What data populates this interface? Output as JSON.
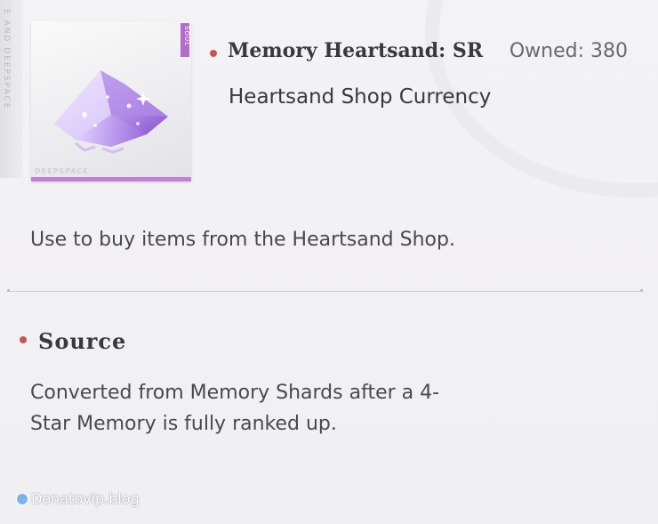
{
  "item": {
    "name": "Memory Heartsand: SR",
    "owned_label": "Owned: 380",
    "type": "Heartsand Shop Currency",
    "description": "Use to buy items from the Heartsand Shop.",
    "card_brand": "DEEPSPACE",
    "card_rarity_tag": "SOUL"
  },
  "side_strip_text": "E AND DEEPSPACE",
  "source": {
    "title": "Source",
    "text": "Converted from Memory Shards after a 4-Star Memory is fully ranked up."
  },
  "watermark": {
    "text": "Donatovip.blog"
  },
  "colors": {
    "accent_dot": "#c8564f",
    "card_accent": "#c27fd8"
  },
  "icons": [
    "heartsand-crystal-icon",
    "bullet-dot-icon"
  ]
}
